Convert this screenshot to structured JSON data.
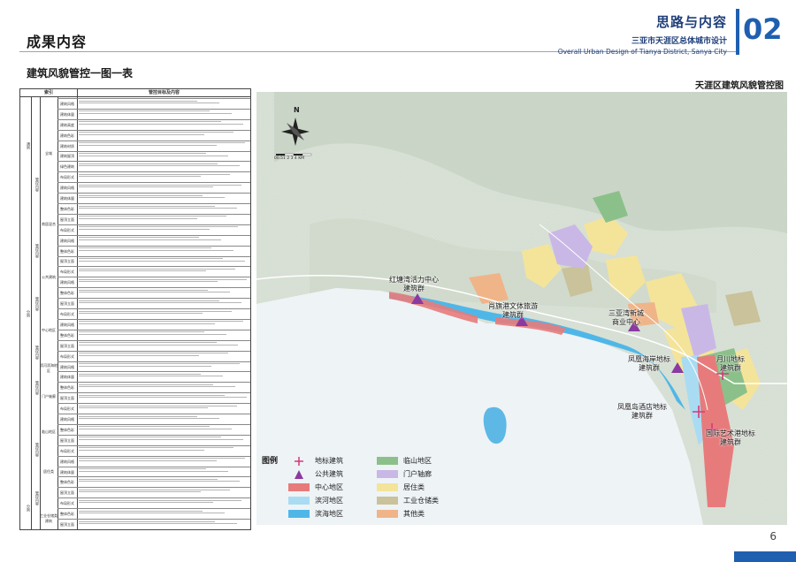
{
  "header": {
    "left_title": "成果内容",
    "right_title": "思路与内容",
    "right_subtitle": "三亚市天涯区总体城市设计",
    "right_english": "Overall Urban Design of Tianya District, Sanya City",
    "chapter_number": "02"
  },
  "section_title": "建筑风貌管控一图一表",
  "map_title": "天涯区建筑风貌管控图",
  "table": {
    "header_index": "索引",
    "header_content": "管控目标及内容",
    "categories": [
      "通则",
      "分则",
      "分则"
    ],
    "sub_labels": [
      "全域",
      "商居混合",
      "公共建筑",
      "中心地区",
      "滨河滨海地区",
      "门户轴廊",
      "临山地区",
      "居住类",
      "工业仓储类建筑"
    ],
    "control_labels": [
      "管控内容",
      "管控内容",
      "管控内容",
      "管控内容",
      "管控内容",
      "管控内容",
      "管控内容"
    ],
    "item_labels": [
      "建筑风格",
      "建筑体量",
      "建筑高度",
      "建筑色彩",
      "建筑材质",
      "建筑屋顶",
      "绿色建筑",
      "布局形式",
      "建筑风格",
      "建筑体量",
      "整体色彩",
      "屋顶立面",
      "布局形式",
      "建筑风格",
      "整体色彩",
      "屋顶立面",
      "布局形式",
      "建筑风格",
      "整体色彩",
      "屋顶立面",
      "布局形式",
      "建筑风格",
      "整体色彩",
      "屋顶立面",
      "布局形式",
      "建筑风格",
      "建筑体量",
      "整体色彩",
      "屋顶立面",
      "布局形式",
      "建筑风格",
      "整体色彩",
      "屋顶立面",
      "布局形式",
      "建筑风格",
      "建筑体量",
      "整体色彩",
      "屋顶立面",
      "布局形式",
      "整体色彩",
      "屋顶立面"
    ]
  },
  "map": {
    "compass_label": "N",
    "scale_label": "00.51  2  3  4 KM",
    "labels": [
      {
        "id": "hongtang",
        "text": "红塘湾活力中心\n建筑群"
      },
      {
        "id": "xiaoqi",
        "text": "肖旗港文体旅游\n建筑群"
      },
      {
        "id": "sanyawan",
        "text": "三亚湾新城\n商业中心"
      },
      {
        "id": "fenghuang_hai",
        "text": "凤凰海岸地标\n建筑群"
      },
      {
        "id": "yuechuan",
        "text": "月川地标\n建筑群"
      },
      {
        "id": "fenghuang_dao",
        "text": "凤凰岛酒店地标\n建筑群"
      },
      {
        "id": "guoji",
        "text": "国际艺术港地标\n建筑群"
      }
    ]
  },
  "legend": {
    "title": "图例",
    "items": [
      {
        "label": "地标建筑",
        "color": "#d33a7a",
        "icon": "cross-marker-icon"
      },
      {
        "label": "公共建筑",
        "color": "#8a3aa0",
        "icon": "triangle-marker-icon"
      },
      {
        "label": "中心地区",
        "color": "#e77b7b"
      },
      {
        "label": "滨河地区",
        "color": "#a9dcf2"
      },
      {
        "label": "滨海地区",
        "color": "#4fb7e8"
      },
      {
        "label": "临山地区",
        "color": "#8cc08a"
      },
      {
        "label": "门户轴廊",
        "color": "#c9b8e6"
      },
      {
        "label": "居住类",
        "color": "#f4e49a"
      },
      {
        "label": "工业仓储类",
        "color": "#c9c29a"
      },
      {
        "label": "其他类",
        "color": "#f0b489"
      }
    ]
  },
  "page_number": "6"
}
